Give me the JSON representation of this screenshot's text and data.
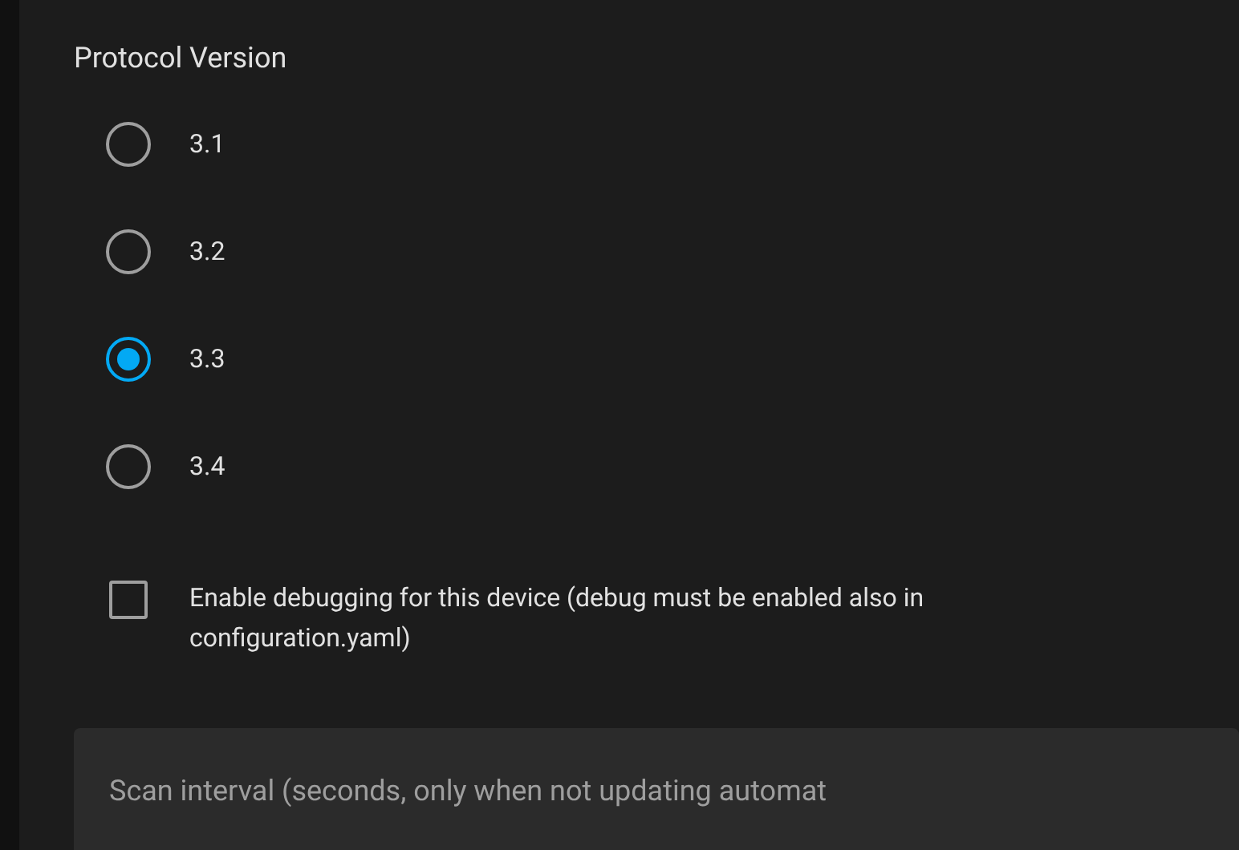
{
  "protocol": {
    "title": "Protocol Version",
    "options": [
      {
        "label": "3.1",
        "selected": false
      },
      {
        "label": "3.2",
        "selected": false
      },
      {
        "label": "3.3",
        "selected": true
      },
      {
        "label": "3.4",
        "selected": false
      }
    ]
  },
  "debug": {
    "label": "Enable debugging for this device (debug must be enabled also in configuration.yaml)",
    "checked": false
  },
  "scan_interval": {
    "label": "Scan interval (seconds, only when not updating automat"
  }
}
